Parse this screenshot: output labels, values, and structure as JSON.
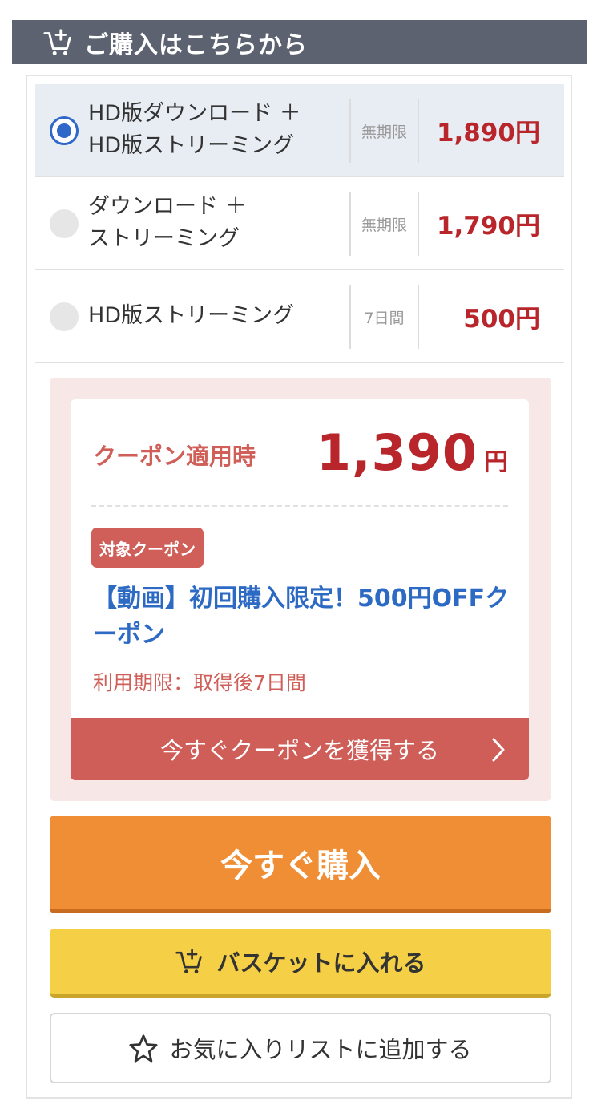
{
  "header": {
    "title": "ご購入はこちらから",
    "icon": "cart-add-icon"
  },
  "options": [
    {
      "label": "HD版ダウンロード ＋\nHD版ストリーミング",
      "period": "無期限",
      "price": "1,890円",
      "selected": true
    },
    {
      "label": "ダウンロード ＋\nストリーミング",
      "period": "無期限",
      "price": "1,790円",
      "selected": false
    },
    {
      "label": "HD版ストリーミング",
      "period": "7日間",
      "price": "500円",
      "selected": false
    }
  ],
  "coupon": {
    "when_label": "クーポン適用時",
    "price": "1,390",
    "price_unit": "円",
    "badge": "対象クーポン",
    "name": "【動画】初回購入限定！500円OFFクーポン",
    "expire": "利用期限：取得後7日間",
    "get_button": "今すぐクーポンを獲得する"
  },
  "actions": {
    "buy_now": "今すぐ購入",
    "add_basket": "バスケットに入れる",
    "add_favorite": "お気に入りリストに追加する"
  },
  "colors": {
    "header_bg": "#5c6270",
    "price_red": "#b8262b",
    "coupon_red": "#cf5f58",
    "coupon_blue": "#2d6ac4",
    "buy_orange": "#f08e35",
    "basket_yellow": "#f5cf45",
    "radio_blue": "#2e68c9"
  }
}
